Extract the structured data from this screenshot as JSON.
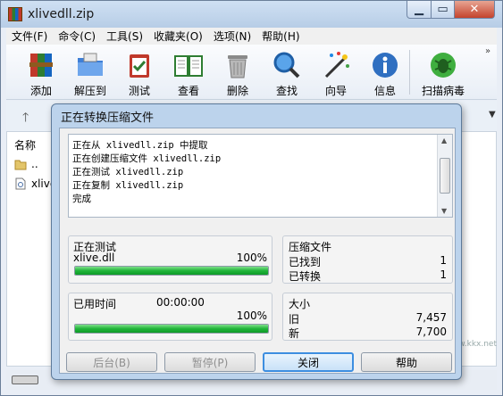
{
  "window": {
    "title": "xlivedll.zip"
  },
  "menu": [
    "文件(F)",
    "命令(C)",
    "工具(S)",
    "收藏夹(O)",
    "选项(N)",
    "帮助(H)"
  ],
  "toolbar": [
    {
      "label": "添加",
      "icon": "add-archive-icon"
    },
    {
      "label": "解压到",
      "icon": "extract-folder-icon"
    },
    {
      "label": "测试",
      "icon": "test-clipboard-icon"
    },
    {
      "label": "查看",
      "icon": "view-book-icon"
    },
    {
      "label": "删除",
      "icon": "delete-trash-icon"
    },
    {
      "label": "查找",
      "icon": "find-magnifier-icon"
    },
    {
      "label": "向导",
      "icon": "wizard-wand-icon"
    },
    {
      "label": "信息",
      "icon": "info-icon"
    },
    {
      "label": "扫描病毒",
      "icon": "scan-virus-icon"
    }
  ],
  "filelist": {
    "column_name": "名称",
    "rows": [
      {
        "name": "..",
        "icon": "folder-up-icon"
      },
      {
        "name": "xlive.",
        "icon": "file-dll-icon"
      }
    ]
  },
  "dialog": {
    "title": "正在转换压缩文件",
    "log": [
      "正在从 xlivedll.zip 中提取",
      "正在创建压缩文件 xlivedll.zip",
      "正在测试 xlivedll.zip",
      "正在复制 xlivedll.zip",
      "完成"
    ],
    "test_panel": {
      "heading": "正在测试",
      "file": "xlive.dll",
      "percent": "100%",
      "progress": 1.0
    },
    "time_panel": {
      "label": "已用时间",
      "time": "00:00:00",
      "percent": "100%",
      "progress": 1.0
    },
    "archive_panel": {
      "heading": "压缩文件",
      "found_label": "已找到",
      "found": "1",
      "converted_label": "已转换",
      "converted": "1"
    },
    "size_panel": {
      "heading": "大小",
      "old_label": "旧",
      "old": "7,457",
      "new_label": "新",
      "new": "7,700"
    },
    "buttons": {
      "background": "后台(B)",
      "pause": "暂停(P)",
      "close": "关闭",
      "help": "帮助"
    }
  },
  "watermark": "www.kkx.net",
  "colors": {
    "progress_green": "#21b53a",
    "dialog_frame": "#bcd3ec",
    "default_button_border": "#3d8ee0"
  }
}
